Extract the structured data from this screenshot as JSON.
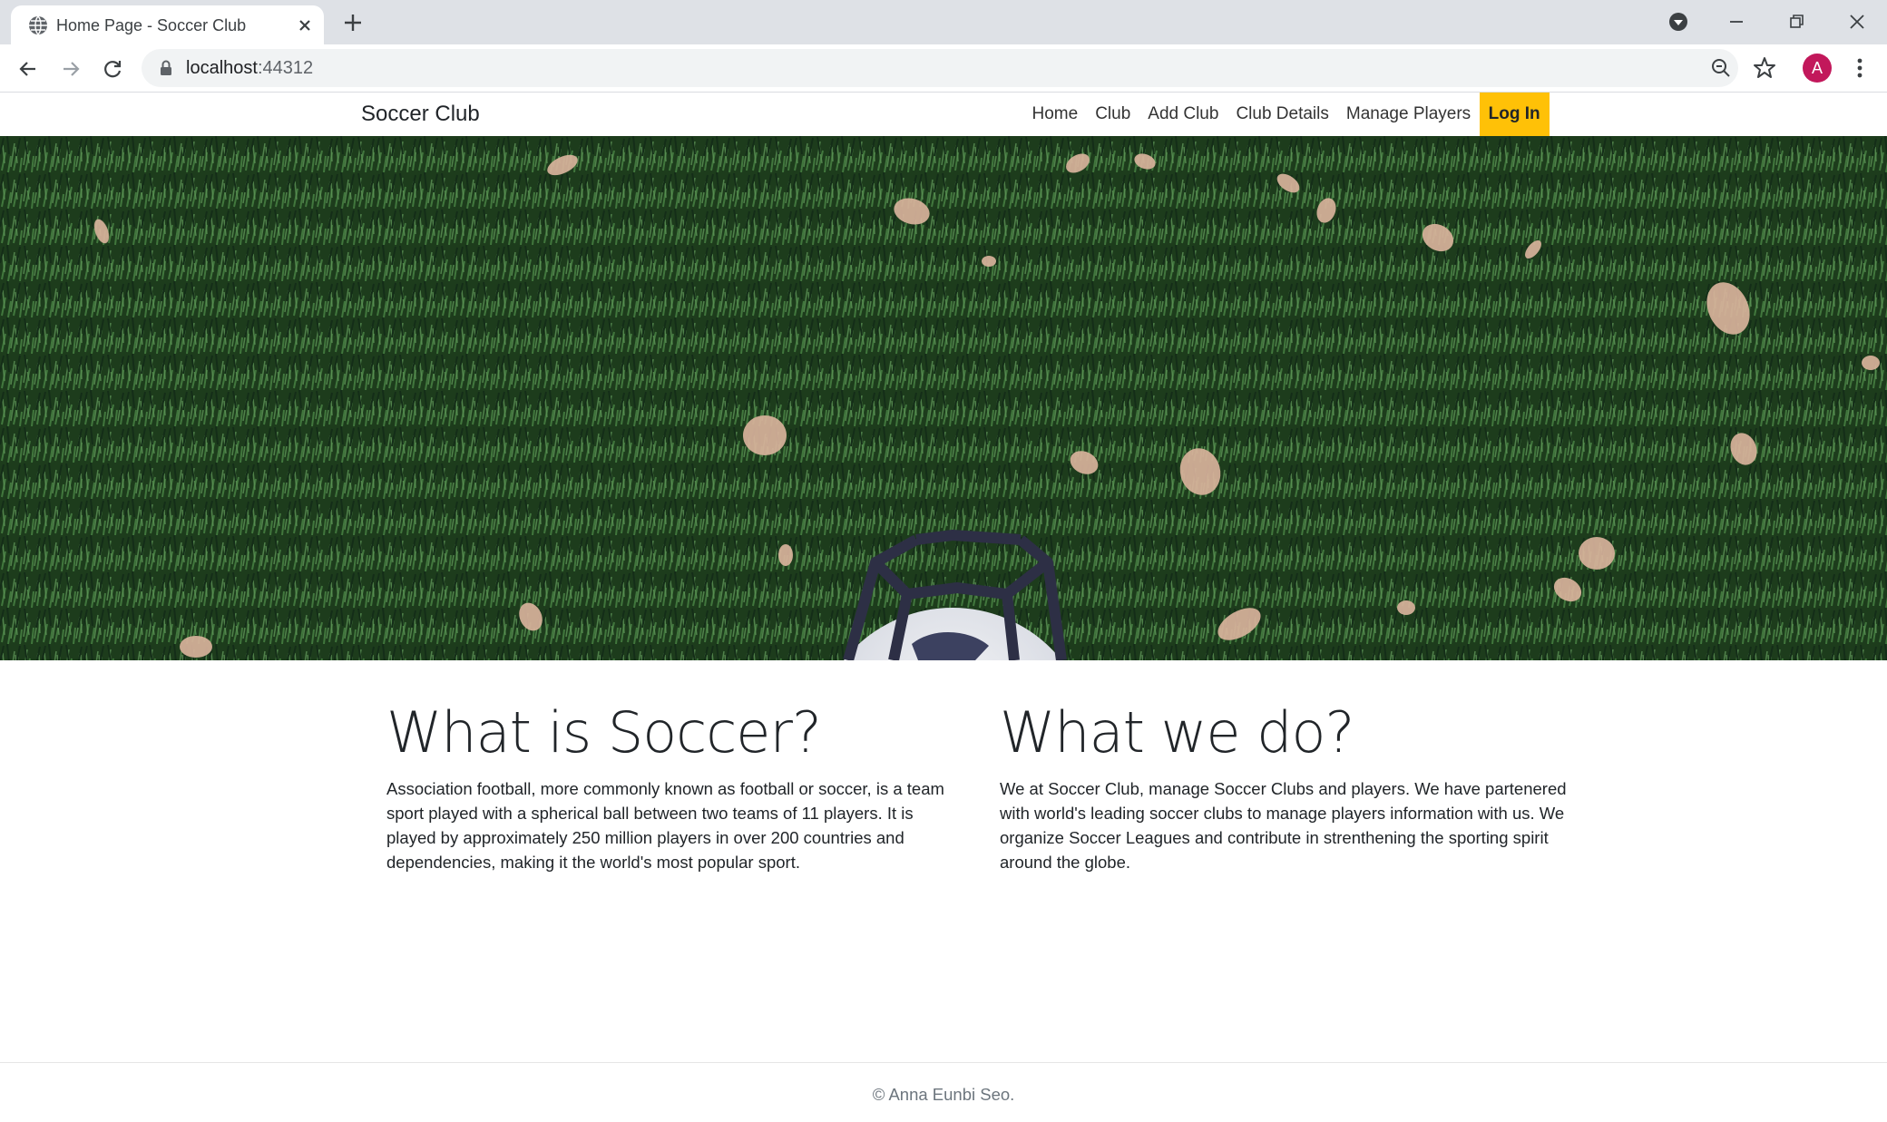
{
  "browser": {
    "tab_title": "Home Page - Soccer Club",
    "url_host": "localhost",
    "url_port": ":44312",
    "profile_initial": "A",
    "icons": [
      "globe-icon",
      "close-icon",
      "plus-icon",
      "profile-dropdown-icon",
      "minimize-icon",
      "restore-icon",
      "window-close-icon",
      "back-icon",
      "forward-icon",
      "reload-icon",
      "lock-icon",
      "zoom-icon",
      "star-icon",
      "more-vertical-icon"
    ]
  },
  "navbar": {
    "brand": "Soccer Club",
    "links": [
      "Home",
      "Club",
      "Add Club",
      "Club Details",
      "Manage Players"
    ],
    "login": "Log In",
    "login_color": "#ffc107"
  },
  "hero": {
    "image": "soccer ball on grass with fallen leaves"
  },
  "content": {
    "left": {
      "heading": "What is Soccer?",
      "text": "Association football, more commonly known as football or soccer, is a team sport played with a spherical ball between two teams of 11 players. It is played by approximately 250 million players in over 200 countries and dependencies, making it the world's most popular sport."
    },
    "right": {
      "heading": "What we do?",
      "text": "We at Soccer Club, manage Soccer Clubs and players. We have partenered with world's leading soccer clubs to manage players information with us. We organize Soccer Leagues and contribute in strenthening the sporting spirit around the globe."
    }
  },
  "footer": {
    "text": "© Anna Eunbi Seo."
  }
}
